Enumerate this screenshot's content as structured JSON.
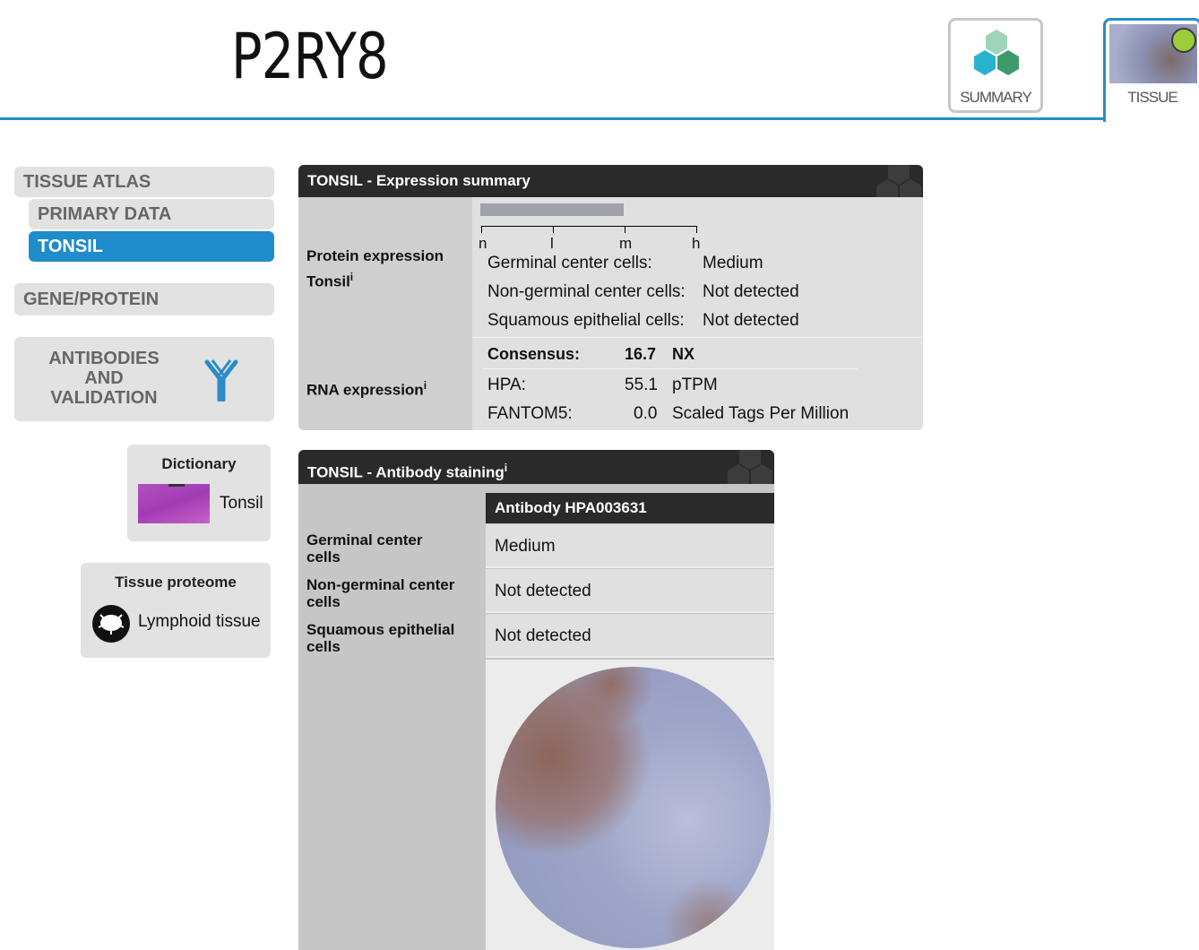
{
  "header": {
    "gene_name": "P2RY8",
    "tabs": [
      {
        "label": "SUMMARY"
      },
      {
        "label": "TISSUE"
      }
    ]
  },
  "sidebar": {
    "tissue_atlas": "TISSUE ATLAS",
    "primary_data": "PRIMARY DATA",
    "tonsil": "TONSIL",
    "gene_protein": "GENE/PROTEIN",
    "antibodies_line1": "ANTIBODIES",
    "antibodies_line2": "AND",
    "antibodies_line3": "VALIDATION",
    "dictionary": {
      "title": "Dictionary",
      "item": "Tonsil"
    },
    "tissue_proteome": {
      "title": "Tissue proteome",
      "item": "Lymphoid tissue"
    }
  },
  "expression_summary": {
    "title": "TONSIL - Expression summary",
    "protein_label_line1": "Protein expression",
    "protein_label_line2": "Tonsil",
    "info": "i",
    "scale": [
      "n",
      "l",
      "m",
      "h"
    ],
    "protein_rows": [
      {
        "cell": "Germinal center cells:",
        "level": "Medium"
      },
      {
        "cell": "Non-germinal center cells:",
        "level": "Not detected"
      },
      {
        "cell": "Squamous epithelial cells:",
        "level": "Not detected"
      }
    ],
    "rna_label": "RNA expression",
    "rna_rows": [
      {
        "source": "Consensus:",
        "value": "16.7",
        "unit": "NX"
      },
      {
        "source": "HPA:",
        "value": "55.1",
        "unit": "pTPM"
      },
      {
        "source": "FANTOM5:",
        "value": "0.0",
        "unit": "Scaled Tags Per Million"
      }
    ]
  },
  "antibody_staining": {
    "title": "TONSIL - Antibody staining",
    "info": "i",
    "antibody": "Antibody HPA003631",
    "rows": [
      {
        "label_line1": "Germinal center",
        "label_line2": "cells",
        "value": "Medium"
      },
      {
        "label_line1": "Non-germinal center",
        "label_line2": "cells",
        "value": "Not detected"
      },
      {
        "label_line1": "Squamous epithelial",
        "label_line2": "cells",
        "value": "Not detected"
      }
    ]
  },
  "colors": {
    "accent": "#1f8ccc",
    "panel_header": "#2a2a2a",
    "status_dot": "#9ccd3c"
  }
}
